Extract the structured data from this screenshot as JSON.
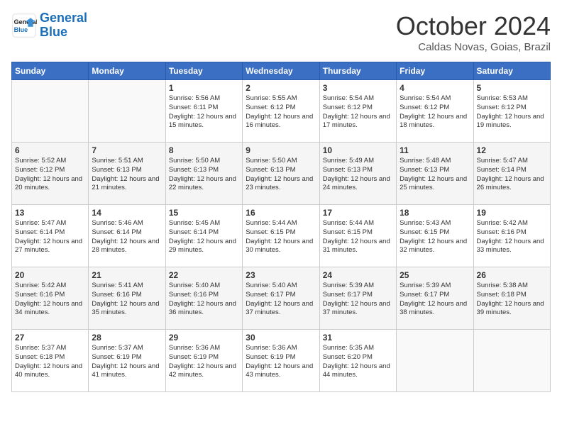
{
  "header": {
    "logo_line1": "General",
    "logo_line2": "Blue",
    "month": "October 2024",
    "location": "Caldas Novas, Goias, Brazil"
  },
  "days_of_week": [
    "Sunday",
    "Monday",
    "Tuesday",
    "Wednesday",
    "Thursday",
    "Friday",
    "Saturday"
  ],
  "weeks": [
    [
      {
        "day": "",
        "info": ""
      },
      {
        "day": "",
        "info": ""
      },
      {
        "day": "1",
        "info": "Sunrise: 5:56 AM\nSunset: 6:11 PM\nDaylight: 12 hours and 15 minutes."
      },
      {
        "day": "2",
        "info": "Sunrise: 5:55 AM\nSunset: 6:12 PM\nDaylight: 12 hours and 16 minutes."
      },
      {
        "day": "3",
        "info": "Sunrise: 5:54 AM\nSunset: 6:12 PM\nDaylight: 12 hours and 17 minutes."
      },
      {
        "day": "4",
        "info": "Sunrise: 5:54 AM\nSunset: 6:12 PM\nDaylight: 12 hours and 18 minutes."
      },
      {
        "day": "5",
        "info": "Sunrise: 5:53 AM\nSunset: 6:12 PM\nDaylight: 12 hours and 19 minutes."
      }
    ],
    [
      {
        "day": "6",
        "info": "Sunrise: 5:52 AM\nSunset: 6:12 PM\nDaylight: 12 hours and 20 minutes."
      },
      {
        "day": "7",
        "info": "Sunrise: 5:51 AM\nSunset: 6:13 PM\nDaylight: 12 hours and 21 minutes."
      },
      {
        "day": "8",
        "info": "Sunrise: 5:50 AM\nSunset: 6:13 PM\nDaylight: 12 hours and 22 minutes."
      },
      {
        "day": "9",
        "info": "Sunrise: 5:50 AM\nSunset: 6:13 PM\nDaylight: 12 hours and 23 minutes."
      },
      {
        "day": "10",
        "info": "Sunrise: 5:49 AM\nSunset: 6:13 PM\nDaylight: 12 hours and 24 minutes."
      },
      {
        "day": "11",
        "info": "Sunrise: 5:48 AM\nSunset: 6:13 PM\nDaylight: 12 hours and 25 minutes."
      },
      {
        "day": "12",
        "info": "Sunrise: 5:47 AM\nSunset: 6:14 PM\nDaylight: 12 hours and 26 minutes."
      }
    ],
    [
      {
        "day": "13",
        "info": "Sunrise: 5:47 AM\nSunset: 6:14 PM\nDaylight: 12 hours and 27 minutes."
      },
      {
        "day": "14",
        "info": "Sunrise: 5:46 AM\nSunset: 6:14 PM\nDaylight: 12 hours and 28 minutes."
      },
      {
        "day": "15",
        "info": "Sunrise: 5:45 AM\nSunset: 6:14 PM\nDaylight: 12 hours and 29 minutes."
      },
      {
        "day": "16",
        "info": "Sunrise: 5:44 AM\nSunset: 6:15 PM\nDaylight: 12 hours and 30 minutes."
      },
      {
        "day": "17",
        "info": "Sunrise: 5:44 AM\nSunset: 6:15 PM\nDaylight: 12 hours and 31 minutes."
      },
      {
        "day": "18",
        "info": "Sunrise: 5:43 AM\nSunset: 6:15 PM\nDaylight: 12 hours and 32 minutes."
      },
      {
        "day": "19",
        "info": "Sunrise: 5:42 AM\nSunset: 6:16 PM\nDaylight: 12 hours and 33 minutes."
      }
    ],
    [
      {
        "day": "20",
        "info": "Sunrise: 5:42 AM\nSunset: 6:16 PM\nDaylight: 12 hours and 34 minutes."
      },
      {
        "day": "21",
        "info": "Sunrise: 5:41 AM\nSunset: 6:16 PM\nDaylight: 12 hours and 35 minutes."
      },
      {
        "day": "22",
        "info": "Sunrise: 5:40 AM\nSunset: 6:16 PM\nDaylight: 12 hours and 36 minutes."
      },
      {
        "day": "23",
        "info": "Sunrise: 5:40 AM\nSunset: 6:17 PM\nDaylight: 12 hours and 37 minutes."
      },
      {
        "day": "24",
        "info": "Sunrise: 5:39 AM\nSunset: 6:17 PM\nDaylight: 12 hours and 37 minutes."
      },
      {
        "day": "25",
        "info": "Sunrise: 5:39 AM\nSunset: 6:17 PM\nDaylight: 12 hours and 38 minutes."
      },
      {
        "day": "26",
        "info": "Sunrise: 5:38 AM\nSunset: 6:18 PM\nDaylight: 12 hours and 39 minutes."
      }
    ],
    [
      {
        "day": "27",
        "info": "Sunrise: 5:37 AM\nSunset: 6:18 PM\nDaylight: 12 hours and 40 minutes."
      },
      {
        "day": "28",
        "info": "Sunrise: 5:37 AM\nSunset: 6:19 PM\nDaylight: 12 hours and 41 minutes."
      },
      {
        "day": "29",
        "info": "Sunrise: 5:36 AM\nSunset: 6:19 PM\nDaylight: 12 hours and 42 minutes."
      },
      {
        "day": "30",
        "info": "Sunrise: 5:36 AM\nSunset: 6:19 PM\nDaylight: 12 hours and 43 minutes."
      },
      {
        "day": "31",
        "info": "Sunrise: 5:35 AM\nSunset: 6:20 PM\nDaylight: 12 hours and 44 minutes."
      },
      {
        "day": "",
        "info": ""
      },
      {
        "day": "",
        "info": ""
      }
    ]
  ]
}
